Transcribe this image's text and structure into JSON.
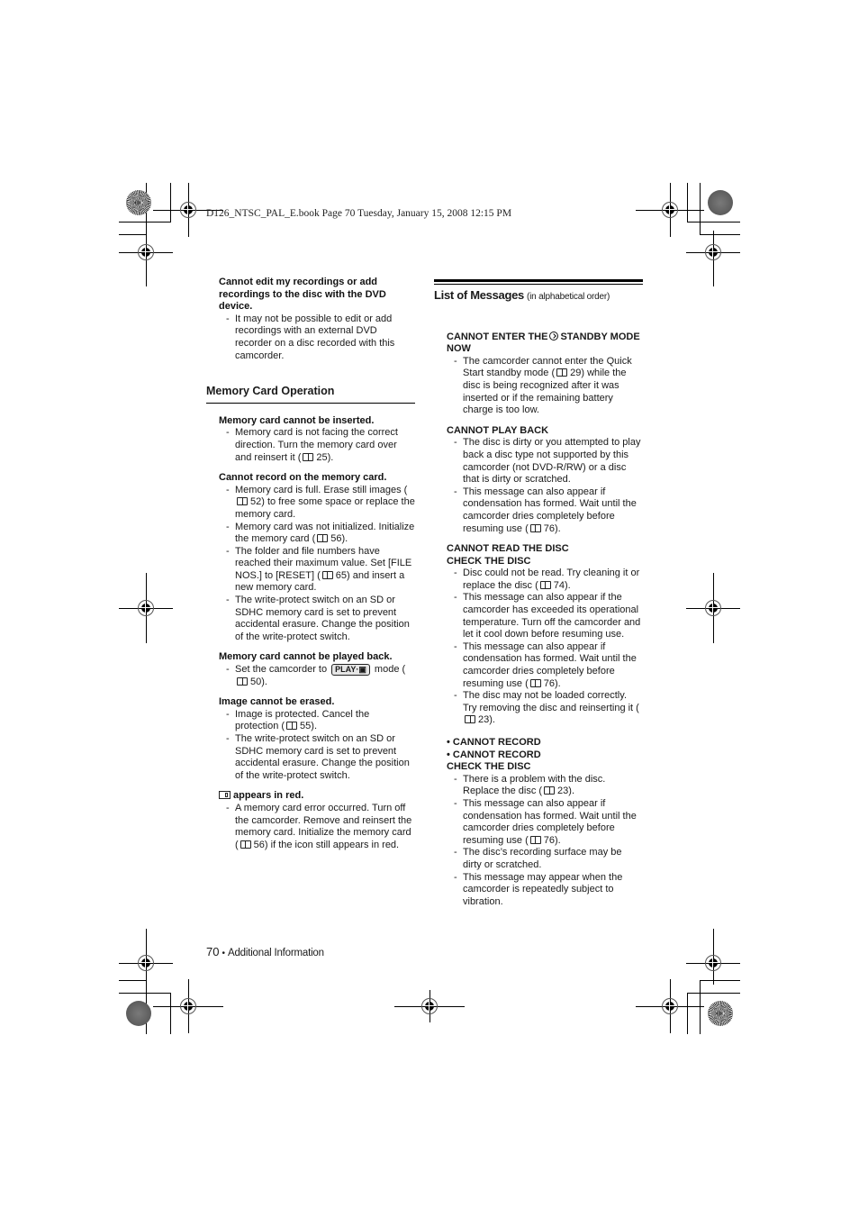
{
  "print_header": "D126_NTSC_PAL_E.book  Page 70  Tuesday, January 15, 2008  12:15 PM",
  "left_column": {
    "intro_block": {
      "question": "Cannot edit my recordings or add recordings to the disc with the DVD device.",
      "answers": [
        "It may not be possible to edit or add recordings with an external DVD recorder on a disc recorded with this camcorder."
      ]
    },
    "section_title": "Memory Card Operation",
    "blocks": [
      {
        "question": "Memory card cannot be inserted.",
        "answers": [
          {
            "text_before": "Memory card is not facing the correct direction. Turn the memory card over and reinsert it (",
            "page_ref": "25",
            "text_after": ")."
          }
        ]
      },
      {
        "question": "Cannot record on the memory card.",
        "answers": [
          {
            "text_before": "Memory card is full. Erase still images (",
            "page_ref": "52",
            "text_after": ") to free some space or replace the memory card."
          },
          {
            "text_before": "Memory card was not initialized. Initialize the memory card (",
            "page_ref": "56",
            "text_after": ")."
          },
          {
            "text_before": "The folder and file numbers have reached their maximum value. Set [FILE NOS.] to [RESET] (",
            "page_ref": "65",
            "text_after": ") and insert a new memory card."
          },
          {
            "text_before": "The write-protect switch on an SD or SDHC memory card is set to prevent accidental erasure. Change the position of the write-protect switch.",
            "page_ref": null,
            "text_after": ""
          }
        ]
      },
      {
        "question": "Memory card cannot be played back.",
        "answers": [
          {
            "text_before": "Set the camcorder to",
            "badge": "PLAY·▣",
            "text_mid": "mode (",
            "page_ref": "50",
            "text_after": ")."
          }
        ]
      },
      {
        "question": "Image cannot be erased.",
        "answers": [
          {
            "text_before": "Image is protected. Cancel the protection (",
            "page_ref": "55",
            "text_after": ")."
          },
          {
            "text_before": "The write-protect switch on an SD or SDHC memory card is set to prevent accidental erasure. Change the position of the write-protect switch.",
            "page_ref": null,
            "text_after": ""
          }
        ]
      },
      {
        "question": "appears in red.",
        "icon": "memory-card-icon",
        "answers": [
          {
            "text_before": "A memory card error occurred. Turn off the camcorder. Remove and reinsert the memory card. Initialize the memory card (",
            "page_ref": "56",
            "text_after": ") if the icon still appears in red."
          }
        ]
      }
    ]
  },
  "right_column": {
    "title": "List of Messages",
    "subtitle": "(in alphabetical order)",
    "messages": [
      {
        "heading_before": "CANNOT ENTER THE",
        "heading_icon": "quick-start-icon",
        "heading_after": "STANDBY MODE NOW",
        "answers": [
          {
            "text_before": "The camcorder cannot enter the Quick Start standby mode (",
            "page_ref": "29",
            "text_after": ") while the disc is being recognized after it was inserted or if the remaining battery charge is too low."
          }
        ]
      },
      {
        "heading_lines": [
          "CANNOT PLAY BACK"
        ],
        "answers": [
          {
            "text_before": "The disc is dirty or you attempted to play back a disc type not supported by this camcorder (not DVD-R/RW) or a disc that is dirty or scratched.",
            "page_ref": null,
            "text_after": ""
          },
          {
            "text_before": "This message can also appear if condensation has formed. Wait until the camcorder dries completely before resuming use (",
            "page_ref": "76",
            "text_after": ")."
          }
        ]
      },
      {
        "heading_lines": [
          "CANNOT READ THE DISC",
          "CHECK THE DISC"
        ],
        "answers": [
          {
            "text_before": "Disc could not be read. Try cleaning it or replace the disc (",
            "page_ref": "74",
            "text_after": ")."
          },
          {
            "text_before": "This message can also appear if the camcorder has exceeded its operational temperature. Turn off the camcorder and let it cool down before resuming use.",
            "page_ref": null,
            "text_after": ""
          },
          {
            "text_before": "This message can also appear if condensation has formed. Wait until the camcorder dries completely before resuming use (",
            "page_ref": "76",
            "text_after": ")."
          },
          {
            "text_before": "The disc may not be loaded correctly. Try removing the disc and reinserting it (",
            "page_ref": "23",
            "text_after": ")."
          }
        ]
      },
      {
        "heading_lines": [
          "• CANNOT RECORD",
          "• CANNOT RECORD",
          "CHECK THE DISC"
        ],
        "answers": [
          {
            "text_before": "There is a problem with the disc. Replace the disc (",
            "page_ref": "23",
            "text_after": ")."
          },
          {
            "text_before": "This message can also appear if condensation has formed. Wait until the camcorder dries completely before resuming use (",
            "page_ref": "76",
            "text_after": ")."
          },
          {
            "text_before": "The disc’s recording surface may be dirty or scratched.",
            "page_ref": null,
            "text_after": ""
          },
          {
            "text_before": "This message may appear when the camcorder is repeatedly subject to vibration.",
            "page_ref": null,
            "text_after": ""
          }
        ]
      }
    ]
  },
  "footer": {
    "page_number": "70",
    "separator": "•",
    "section": "Additional Information"
  }
}
